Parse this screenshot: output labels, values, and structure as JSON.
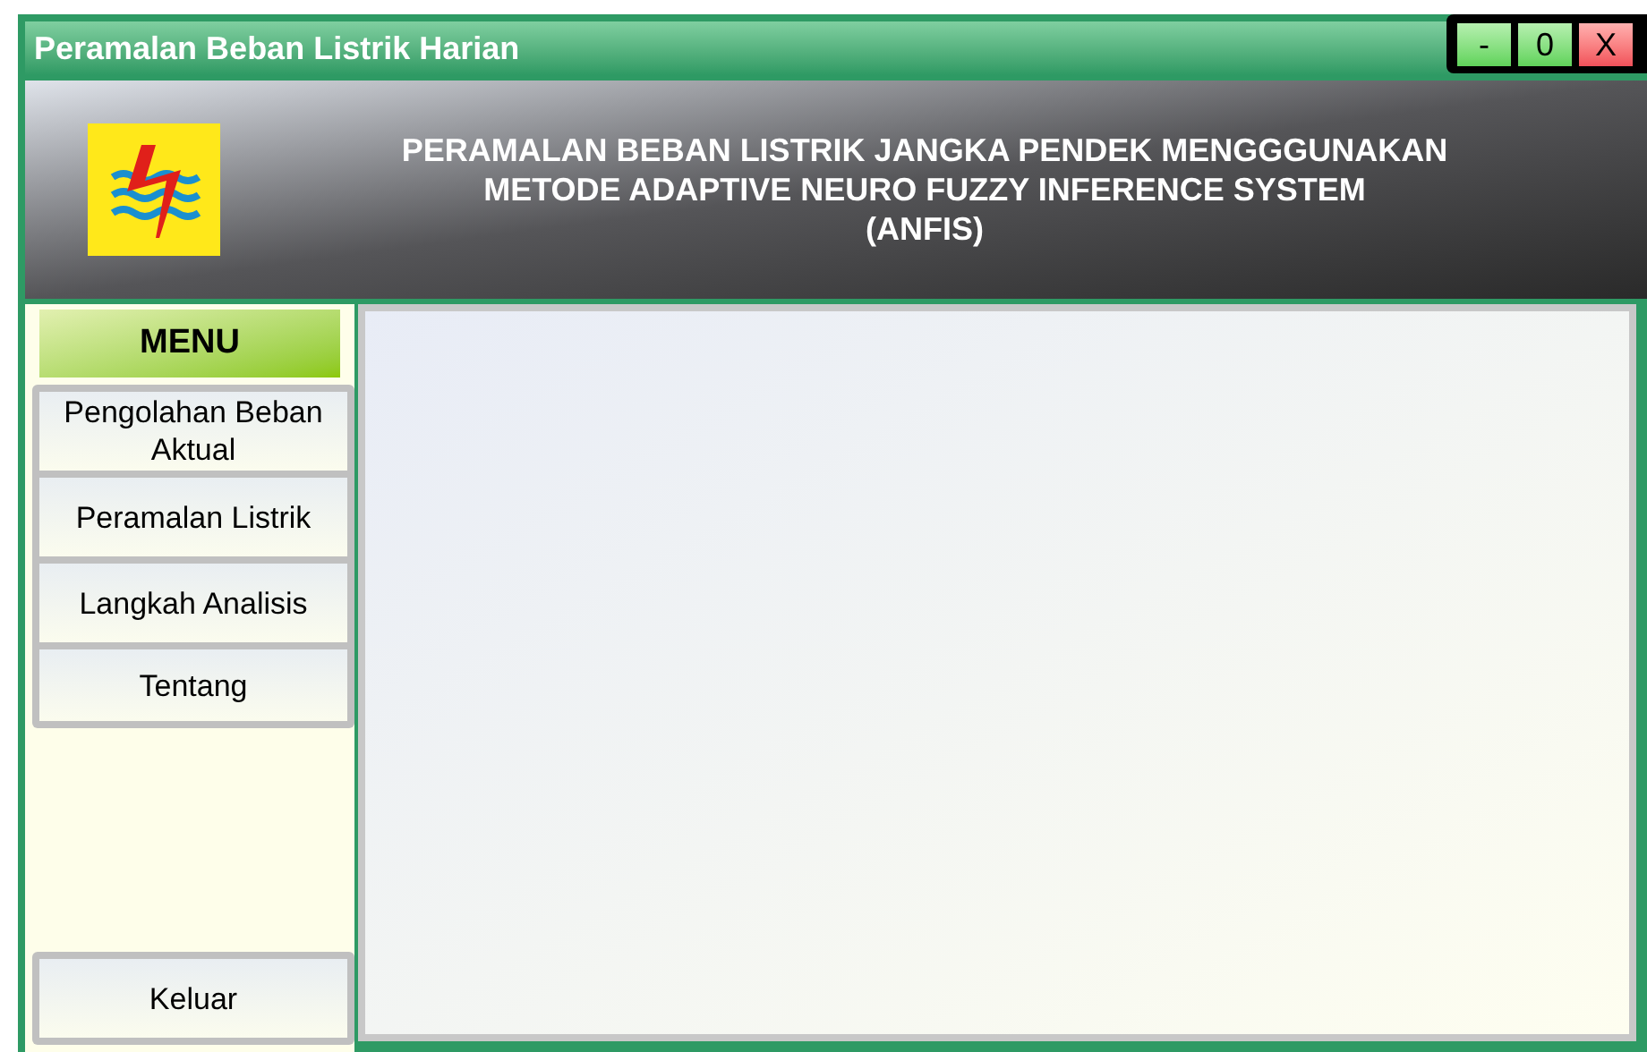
{
  "window": {
    "title": "Peramalan Beban Listrik Harian",
    "controls": [
      {
        "kind": "minimize",
        "label": "-"
      },
      {
        "kind": "maximize",
        "label": "0"
      },
      {
        "kind": "close",
        "label": "X"
      }
    ]
  },
  "header": {
    "title_lines": [
      "PERAMALAN BEBAN LISTRIK JANGKA PENDEK MENGGGUNAKAN",
      "METODE ADAPTIVE NEURO FUZZY INFERENCE SYSTEM",
      "(ANFIS)"
    ]
  },
  "sidebar": {
    "heading": "MENU",
    "items": [
      {
        "label": "Pengolahan Beban Aktual"
      },
      {
        "label": "Peramalan Listrik"
      },
      {
        "label": "Langkah Analisis"
      },
      {
        "label": "Tentang"
      }
    ],
    "exit": "Keluar"
  }
}
